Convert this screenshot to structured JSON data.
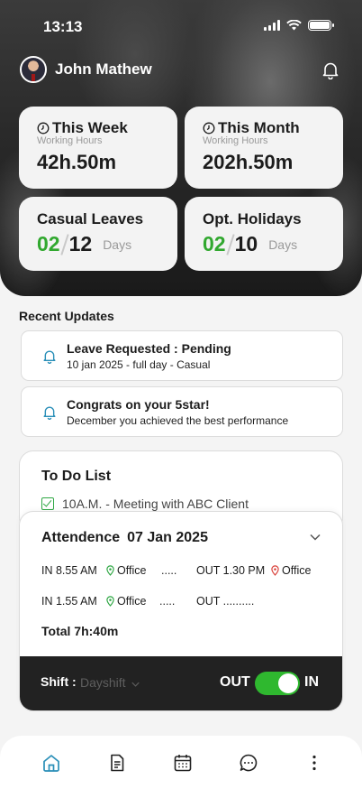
{
  "status_bar": {
    "time": "13:13",
    "signal_icon": "signal-icon",
    "wifi_icon": "wifi-icon",
    "battery_icon": "battery-icon"
  },
  "header": {
    "user_name": "John Mathew",
    "avatar_icon": "avatar",
    "notification_icon": "bell-icon"
  },
  "stats": {
    "week": {
      "title": "This Week",
      "subtitle": "Working Hours",
      "value": "42h.50m",
      "icon": "clock-icon"
    },
    "month": {
      "title": "This Month",
      "subtitle": "Working Hours",
      "value": "202h.50m",
      "icon": "clock-icon"
    },
    "casual": {
      "title": "Casual Leaves",
      "used": "02",
      "total": "12",
      "unit": "Days"
    },
    "holidays": {
      "title": "Opt. Holidays",
      "used": "02",
      "total": "10",
      "unit": "Days"
    }
  },
  "recent": {
    "title": "Recent Updates",
    "items": [
      {
        "title": "Leave Requested : Pending",
        "detail": "10 jan 2025 - full day - Casual"
      },
      {
        "title": "Congrats on your 5star!",
        "detail": "December you achieved the best performance"
      }
    ]
  },
  "todo": {
    "title": "To Do List",
    "items": [
      {
        "label": "10A.M. - Meeting with ABC Client",
        "checked": true
      }
    ]
  },
  "attendance": {
    "title": "Attendence",
    "date": "07 Jan 2025",
    "rows": [
      {
        "in": "IN 8.55 AM",
        "in_place": "Office",
        "dots": ".....",
        "out": "OUT 1.30 PM",
        "out_place": "Office"
      },
      {
        "in": "IN 1.55 AM",
        "in_place": "Office",
        "dots": ".....",
        "out": "OUT ..........",
        "out_place": ""
      }
    ],
    "total": "Total 7h:40m"
  },
  "shift": {
    "label": "Shift :",
    "value": "Dayshift",
    "out_label": "OUT",
    "in_label": "IN",
    "toggle_state": "IN"
  },
  "colors": {
    "accent_green": "#31a82f",
    "bell_blue": "#2a8fb8",
    "pin_green": "#2fa744",
    "pin_red": "#d9413a"
  },
  "bottom_nav": [
    {
      "name": "home-icon",
      "active": true
    },
    {
      "name": "document-icon",
      "active": false
    },
    {
      "name": "calendar-icon",
      "active": false
    },
    {
      "name": "chat-icon",
      "active": false
    },
    {
      "name": "more-icon",
      "active": false
    }
  ]
}
